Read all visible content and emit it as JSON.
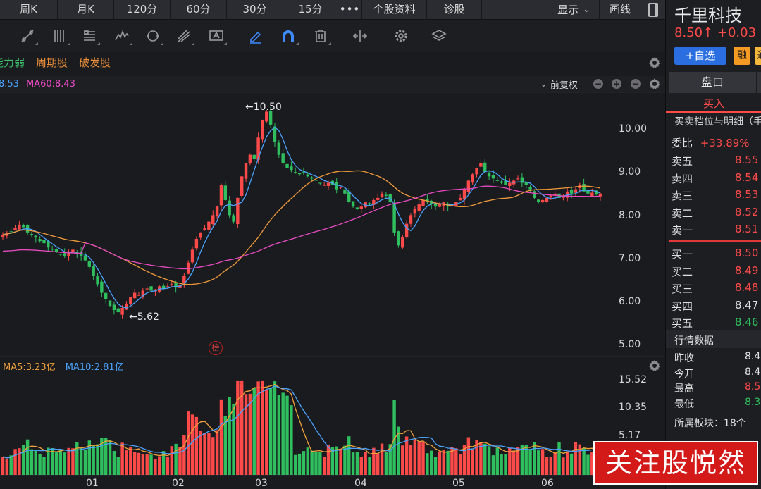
{
  "tabs": [
    "周K",
    "月K",
    "120分",
    "60分",
    "30分",
    "15分",
    "•••",
    "个股资料",
    "诊股"
  ],
  "tab_right": {
    "display": "显示",
    "draw": "画线"
  },
  "toolbar_icons": [
    "trend-line-icon",
    "parallel-line-icon",
    "fib-icon",
    "wave-icon",
    "cycle-icon",
    "fork-icon",
    "text-annotation-icon",
    "pen-icon",
    "magnet-icon",
    "trash-icon",
    "split-icon",
    "settings-icon",
    "layers-icon"
  ],
  "tags": [
    {
      "label": "能力弱",
      "color": "#3cc06a"
    },
    {
      "label": "周期股",
      "color": "#f0923a"
    },
    {
      "label": "破发股",
      "color": "#f0923a"
    }
  ],
  "ma_legend": {
    "ma_left": "8.53",
    "ma60": "MA60:8.43"
  },
  "adjust": "前复权",
  "price_ticks": [
    "10.00",
    "9.00",
    "8.00",
    "7.00",
    "6.00",
    "5.00"
  ],
  "annotations": {
    "high": "←10.50",
    "low": "←5.62",
    "rank_badge": "榜"
  },
  "volume_legend": {
    "ma5": "MA5:3.23亿",
    "ma10": "MA10:2.81亿"
  },
  "volume_ticks": [
    "15.52",
    "10.35",
    "5.17"
  ],
  "months": [
    "01",
    "02",
    "03",
    "04",
    "05",
    "06"
  ],
  "colors": {
    "up": "#ff4a4a",
    "down": "#2fbf5f",
    "ma5": "#f2a13a",
    "ma10": "#4aa3ff",
    "ma60": "#e94bc3",
    "ma30": "#f09a3a"
  },
  "chart_data": {
    "type": "candlestick",
    "price_range": [
      5.0,
      10.5
    ],
    "high_marker": 10.5,
    "low_marker": 5.62,
    "closes": [
      7.55,
      7.58,
      7.62,
      7.7,
      7.78,
      7.72,
      7.6,
      7.55,
      7.48,
      7.4,
      7.35,
      7.25,
      7.2,
      7.15,
      7.1,
      7.05,
      7.15,
      7.2,
      7.1,
      7.05,
      6.95,
      6.8,
      6.6,
      6.4,
      6.2,
      6.05,
      5.9,
      5.8,
      5.75,
      5.85,
      5.95,
      6.1,
      6.2,
      6.15,
      6.25,
      6.3,
      6.25,
      6.28,
      6.35,
      6.3,
      6.35,
      6.4,
      6.32,
      6.38,
      6.6,
      6.9,
      7.2,
      7.45,
      7.6,
      7.7,
      7.85,
      8.0,
      8.2,
      8.7,
      8.35,
      8.0,
      7.85,
      8.4,
      8.9,
      9.2,
      9.4,
      9.3,
      9.8,
      10.2,
      10.4,
      10.1,
      9.7,
      9.4,
      9.2,
      9.1,
      9.05,
      9.0,
      8.95,
      9.0,
      8.9,
      8.85,
      8.8,
      8.75,
      8.7,
      8.75,
      8.7,
      8.6,
      8.65,
      8.5,
      8.3,
      8.2,
      8.15,
      8.2,
      8.3,
      8.25,
      8.35,
      8.4,
      8.5,
      8.45,
      8.3,
      7.6,
      7.3,
      7.5,
      7.8,
      8.0,
      8.15,
      8.25,
      8.35,
      8.3,
      8.25,
      8.2,
      8.25,
      8.3,
      8.2,
      8.25,
      8.3,
      8.4,
      8.6,
      8.8,
      8.95,
      9.1,
      9.2,
      9.0,
      8.9,
      8.85,
      8.8,
      8.75,
      8.7,
      8.75,
      8.8,
      8.85,
      8.75,
      8.7,
      8.6,
      8.4,
      8.3,
      8.35,
      8.4,
      8.45,
      8.5,
      8.4,
      8.45,
      8.55,
      8.5,
      8.6,
      8.7,
      8.55,
      8.5,
      8.52,
      8.48,
      8.5
    ],
    "volume_range": [
      0,
      15.52
    ],
    "volume_unit": "亿",
    "ma5_vol_last": 3.23,
    "ma10_vol_last": 2.81,
    "ma60_last": 8.43
  },
  "right_panel": {
    "name": "千里科技",
    "price_change": "8.50↑ +0.03",
    "add_watch": "+自选",
    "rong": "融",
    "rong2": "通",
    "tab_pankou": "盘口",
    "buy_tab": "买入",
    "sub_title": "买卖档位与明细（手",
    "weibi_label": "委比",
    "weibi_value": "+33.89%",
    "asks": [
      {
        "label": "卖五",
        "price": "8.55",
        "color": "#ff4a4a"
      },
      {
        "label": "卖四",
        "price": "8.54",
        "color": "#ff4a4a"
      },
      {
        "label": "卖三",
        "price": "8.53",
        "color": "#ff4a4a"
      },
      {
        "label": "卖二",
        "price": "8.52",
        "color": "#ff4a4a"
      },
      {
        "label": "卖一",
        "price": "8.51",
        "color": "#ff4a4a"
      }
    ],
    "bids": [
      {
        "label": "买一",
        "price": "8.50",
        "color": "#ff4a4a"
      },
      {
        "label": "买二",
        "price": "8.49",
        "color": "#ff4a4a"
      },
      {
        "label": "买三",
        "price": "8.48",
        "color": "#ff4a4a"
      },
      {
        "label": "买四",
        "price": "8.47",
        "color": "#e0e0e0"
      },
      {
        "label": "买五",
        "price": "8.46",
        "color": "#2fbf5f"
      }
    ],
    "market_section": "行情数据",
    "stats": [
      {
        "label": "昨收",
        "value": "8.4",
        "color": "#e0e0e0"
      },
      {
        "label": "今开",
        "value": "8.4",
        "color": "#e0e0e0"
      },
      {
        "label": "最高",
        "value": "8.5",
        "color": "#ff4a4a"
      },
      {
        "label": "最低",
        "value": "8.3",
        "color": "#2fbf5f"
      }
    ],
    "block_label": "所属板块：18个"
  },
  "watermark": "关注股悦然"
}
